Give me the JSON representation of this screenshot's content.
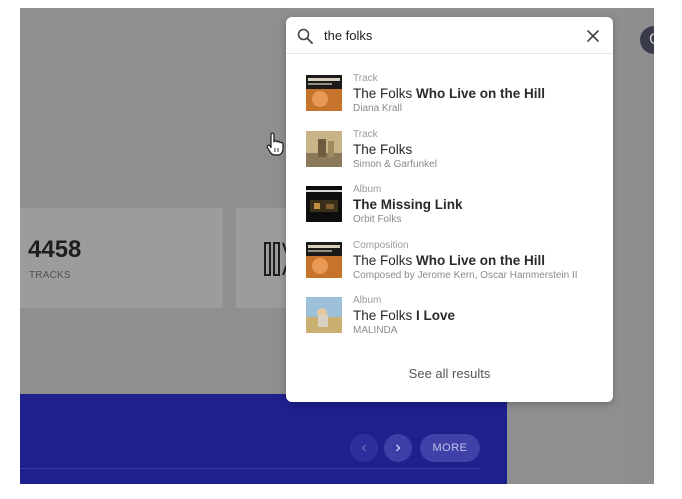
{
  "search": {
    "query": "the folks",
    "see_all_label": "See all results"
  },
  "results": [
    {
      "type": "Track",
      "title_plain": "The Folks",
      "title_bold": "Who Live on the Hill",
      "subtitle": "Diana Krall",
      "thumb_text": "DIANA KRALL"
    },
    {
      "type": "Track",
      "title_plain": "The Folks",
      "title_bold": "",
      "subtitle": "Simon & Garfunkel",
      "thumb_text": ""
    },
    {
      "type": "Album",
      "title_plain": "",
      "title_bold": "The Missing Link",
      "subtitle": "Orbit Folks",
      "thumb_text": ""
    },
    {
      "type": "Composition",
      "title_plain": "The Folks",
      "title_bold": "Who Live on the Hill",
      "subtitle": "Composed by Jerome Kern, Oscar Hammerstein II",
      "thumb_text": "DIANA KRALL"
    },
    {
      "type": "Album",
      "title_plain": "The Folks",
      "title_bold": "I Love",
      "subtitle": "MALINDA",
      "thumb_text": ""
    }
  ],
  "background": {
    "stat_value": "4458",
    "stat_label": "TRACKS",
    "more_label": "MORE",
    "avatar_initial": "C"
  },
  "colors": {
    "blue_panel": "#1e208e",
    "overlay_gray": "#8f8f8f"
  }
}
